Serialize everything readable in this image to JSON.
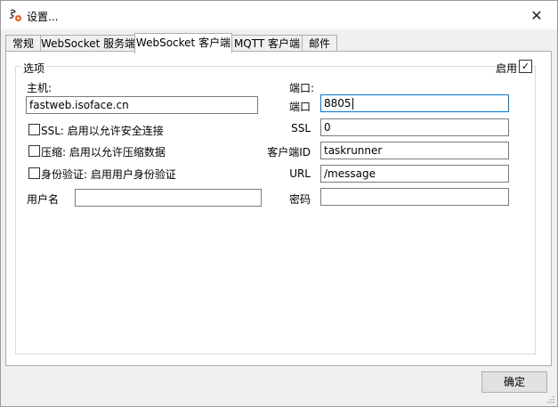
{
  "window": {
    "title": "设置...",
    "close_glyph": "✕"
  },
  "tabs": [
    "常规",
    "WebSocket 服务端",
    "WebSocket 客户端",
    "MQTT 客户端",
    "邮件"
  ],
  "group": {
    "title": "选项",
    "enable_label": "启用",
    "enable_checked": true,
    "check_glyph": "✓"
  },
  "left": {
    "host_label": "主机:",
    "host_value": "fastweb.isoface.cn",
    "ssl_check_label": "SSL: 启用以允许安全连接",
    "compress_check_label": "压缩: 启用以允许压缩数据",
    "auth_check_label": "身份验证: 启用用户身份验证",
    "username_label": "用户名",
    "username_value": ""
  },
  "right": {
    "port_header": "端口:",
    "port_label": "端口",
    "port_value": "8805",
    "ssl_label": "SSL",
    "ssl_value": "0",
    "client_id_label": "客户端ID",
    "client_id_value": "taskrunner",
    "url_label": "URL",
    "url_value": "/message",
    "password_label": "密码",
    "password_value": ""
  },
  "footer": {
    "ok_label": "确定"
  }
}
